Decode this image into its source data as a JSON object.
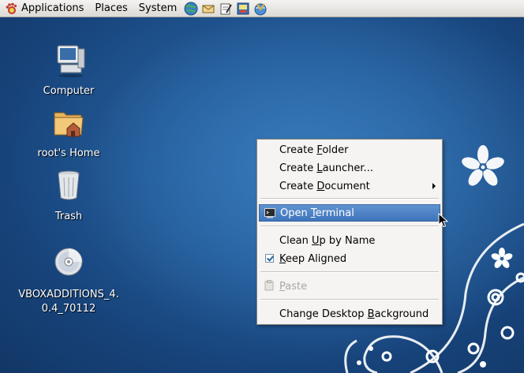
{
  "panel": {
    "menus": [
      {
        "label": "Applications",
        "icon": "gnome-foot-icon"
      },
      {
        "label": "Places"
      },
      {
        "label": "System"
      }
    ],
    "launchers": [
      "web-browser-icon",
      "email-icon",
      "text-editor-icon",
      "notes-icon",
      "network-icon"
    ]
  },
  "desktop": {
    "icons": [
      {
        "label": "Computer",
        "icon": "computer-icon"
      },
      {
        "label": "root's Home",
        "icon": "home-folder-icon"
      },
      {
        "label": "Trash",
        "icon": "trash-icon"
      },
      {
        "label_line1": "VBOXADDITIONS_4.",
        "label_line2": "0.4_70112",
        "icon": "cd-icon"
      }
    ]
  },
  "context_menu": {
    "items": [
      {
        "label": "Create Folder",
        "mnemonic": "F"
      },
      {
        "label": "Create Launcher...",
        "mnemonic": "L"
      },
      {
        "label": "Create Document",
        "mnemonic": "D",
        "submenu": true
      },
      {
        "label": "Open Terminal",
        "mnemonic": "T",
        "selected": true,
        "icon": "terminal-icon"
      },
      {
        "label": "Clean Up by Name",
        "mnemonic": "U"
      },
      {
        "label": "Keep Aligned",
        "mnemonic": "K",
        "checked": true
      },
      {
        "label": "Paste",
        "mnemonic": "P",
        "disabled": true,
        "icon": "paste-icon"
      },
      {
        "label": "Change Desktop Background",
        "mnemonic": "B"
      }
    ]
  },
  "colors": {
    "desktop_bg": "#235b98",
    "menu_highlight": "#4a7fc1",
    "panel_bg": "#e8e6e1"
  }
}
